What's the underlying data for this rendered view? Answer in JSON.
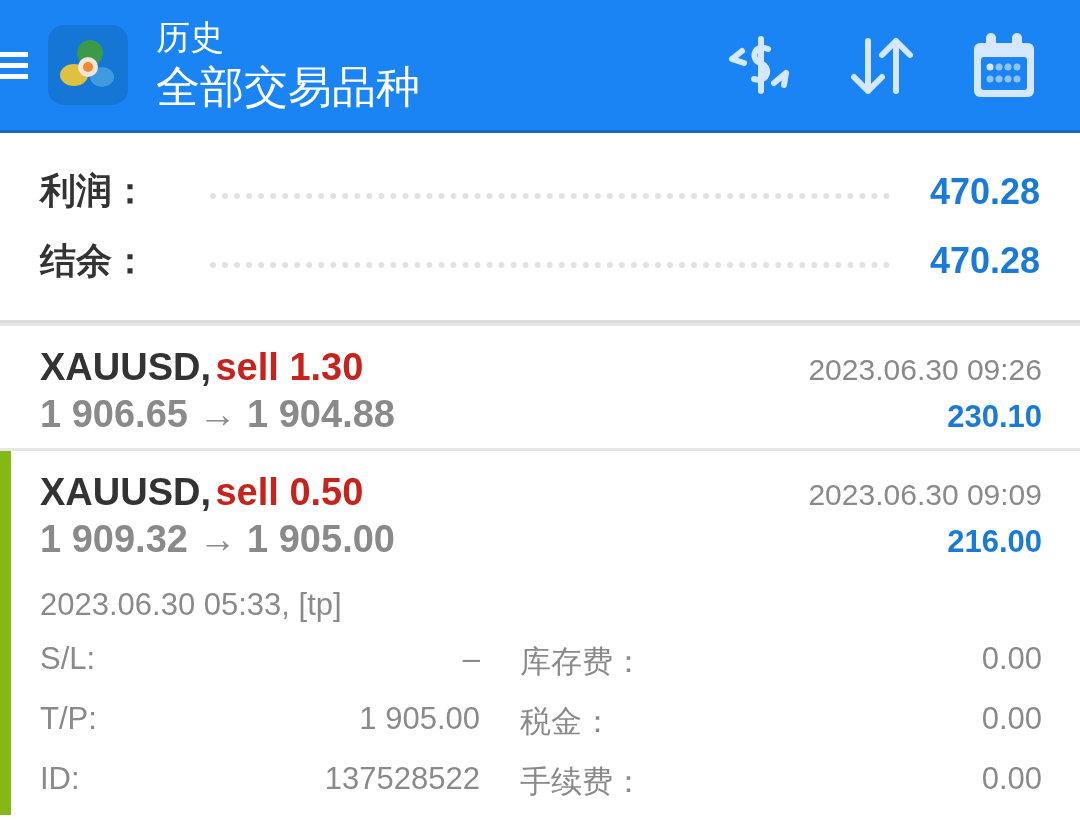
{
  "header": {
    "title": "历史",
    "subtitle": "全部交易品种"
  },
  "summary": [
    {
      "label": "利润：",
      "value": "470.28"
    },
    {
      "label": "结余：",
      "value": "470.28"
    }
  ],
  "trades": [
    {
      "symbol": "XAUUSD,",
      "side": "sell 1.30",
      "prices": "1 906.65 → 1 904.88",
      "time": "2023.06.30 09:26",
      "profit": "230.10",
      "selected": false
    },
    {
      "symbol": "XAUUSD,",
      "side": "sell 0.50",
      "prices": "1 909.32 → 1 905.00",
      "time": "2023.06.30 09:09",
      "profit": "216.00",
      "selected": true,
      "open_info": "2023.06.30 05:33, [tp]",
      "details": [
        {
          "label": "S/L:",
          "value": "–"
        },
        {
          "label": "库存费：",
          "value": "0.00"
        },
        {
          "label": "T/P:",
          "value": "1 905.00"
        },
        {
          "label": "税金：",
          "value": "0.00"
        },
        {
          "label": "ID:",
          "value": "137528522"
        },
        {
          "label": "手续费：",
          "value": "0.00"
        }
      ]
    }
  ]
}
